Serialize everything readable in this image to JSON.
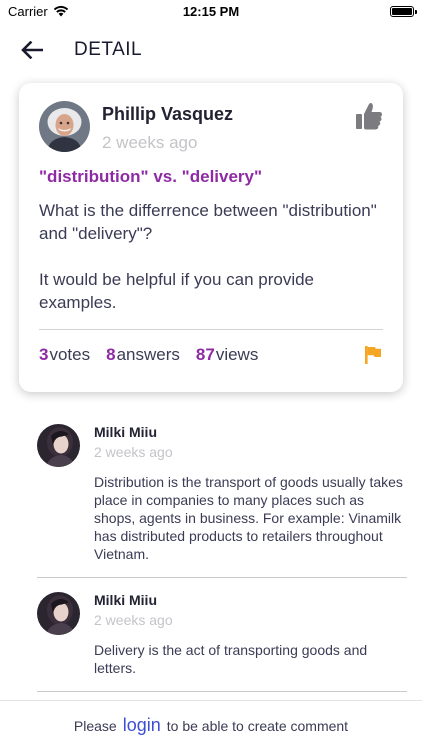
{
  "status_bar": {
    "carrier": "Carrier",
    "time": "12:15 PM",
    "battery_level": 1.0
  },
  "header": {
    "title": "DETAIL",
    "back_icon": "arrow-left-icon"
  },
  "question": {
    "author_name": "Phillip Vasquez",
    "time_ago": "2 weeks ago",
    "title": "\"distribution\" vs. \"delivery\"",
    "body": "What is the differrence between \"distribution\" and \"delivery\"?\n\nIt would be helpful if you can provide examples.",
    "votes": {
      "count": "3",
      "label": "votes"
    },
    "answers": {
      "count": "8",
      "label": "answers"
    },
    "views": {
      "count": "87",
      "label": "views"
    },
    "like_icon": "thumbs-up-icon",
    "flag_icon": "flag-icon"
  },
  "comments": [
    {
      "author": "Milki Miiu",
      "time_ago": "2 weeks ago",
      "text": "Distribution is the transport of goods usually takes place in companies to many places such as shops, agents in business. For example: Vinamilk has distributed products to retailers throughout Vietnam."
    },
    {
      "author": "Milki Miiu",
      "time_ago": "2 weeks ago",
      "text": "Delivery is the act of transporting goods and letters."
    }
  ],
  "footer": {
    "prefix": "Please",
    "link": "login",
    "suffix": "to be able to create comment"
  },
  "colors": {
    "accent": "#8f2aa5",
    "link": "#3d4fd1",
    "flag": "#f5a623",
    "muted": "#c4c4c8"
  }
}
